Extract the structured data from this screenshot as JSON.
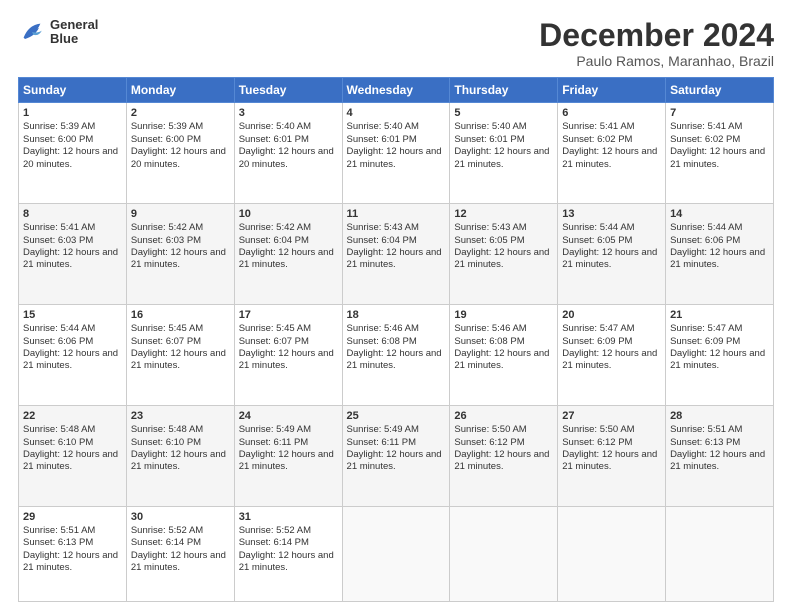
{
  "logo": {
    "line1": "General",
    "line2": "Blue"
  },
  "title": "December 2024",
  "subtitle": "Paulo Ramos, Maranhao, Brazil",
  "days": [
    "Sunday",
    "Monday",
    "Tuesday",
    "Wednesday",
    "Thursday",
    "Friday",
    "Saturday"
  ],
  "weeks": [
    [
      {
        "num": "1",
        "sunrise": "5:39 AM",
        "sunset": "6:00 PM",
        "daylight": "12 hours and 20 minutes."
      },
      {
        "num": "2",
        "sunrise": "5:39 AM",
        "sunset": "6:00 PM",
        "daylight": "12 hours and 20 minutes."
      },
      {
        "num": "3",
        "sunrise": "5:40 AM",
        "sunset": "6:01 PM",
        "daylight": "12 hours and 20 minutes."
      },
      {
        "num": "4",
        "sunrise": "5:40 AM",
        "sunset": "6:01 PM",
        "daylight": "12 hours and 21 minutes."
      },
      {
        "num": "5",
        "sunrise": "5:40 AM",
        "sunset": "6:01 PM",
        "daylight": "12 hours and 21 minutes."
      },
      {
        "num": "6",
        "sunrise": "5:41 AM",
        "sunset": "6:02 PM",
        "daylight": "12 hours and 21 minutes."
      },
      {
        "num": "7",
        "sunrise": "5:41 AM",
        "sunset": "6:02 PM",
        "daylight": "12 hours and 21 minutes."
      }
    ],
    [
      {
        "num": "8",
        "sunrise": "5:41 AM",
        "sunset": "6:03 PM",
        "daylight": "12 hours and 21 minutes."
      },
      {
        "num": "9",
        "sunrise": "5:42 AM",
        "sunset": "6:03 PM",
        "daylight": "12 hours and 21 minutes."
      },
      {
        "num": "10",
        "sunrise": "5:42 AM",
        "sunset": "6:04 PM",
        "daylight": "12 hours and 21 minutes."
      },
      {
        "num": "11",
        "sunrise": "5:43 AM",
        "sunset": "6:04 PM",
        "daylight": "12 hours and 21 minutes."
      },
      {
        "num": "12",
        "sunrise": "5:43 AM",
        "sunset": "6:05 PM",
        "daylight": "12 hours and 21 minutes."
      },
      {
        "num": "13",
        "sunrise": "5:44 AM",
        "sunset": "6:05 PM",
        "daylight": "12 hours and 21 minutes."
      },
      {
        "num": "14",
        "sunrise": "5:44 AM",
        "sunset": "6:06 PM",
        "daylight": "12 hours and 21 minutes."
      }
    ],
    [
      {
        "num": "15",
        "sunrise": "5:44 AM",
        "sunset": "6:06 PM",
        "daylight": "12 hours and 21 minutes."
      },
      {
        "num": "16",
        "sunrise": "5:45 AM",
        "sunset": "6:07 PM",
        "daylight": "12 hours and 21 minutes."
      },
      {
        "num": "17",
        "sunrise": "5:45 AM",
        "sunset": "6:07 PM",
        "daylight": "12 hours and 21 minutes."
      },
      {
        "num": "18",
        "sunrise": "5:46 AM",
        "sunset": "6:08 PM",
        "daylight": "12 hours and 21 minutes."
      },
      {
        "num": "19",
        "sunrise": "5:46 AM",
        "sunset": "6:08 PM",
        "daylight": "12 hours and 21 minutes."
      },
      {
        "num": "20",
        "sunrise": "5:47 AM",
        "sunset": "6:09 PM",
        "daylight": "12 hours and 21 minutes."
      },
      {
        "num": "21",
        "sunrise": "5:47 AM",
        "sunset": "6:09 PM",
        "daylight": "12 hours and 21 minutes."
      }
    ],
    [
      {
        "num": "22",
        "sunrise": "5:48 AM",
        "sunset": "6:10 PM",
        "daylight": "12 hours and 21 minutes."
      },
      {
        "num": "23",
        "sunrise": "5:48 AM",
        "sunset": "6:10 PM",
        "daylight": "12 hours and 21 minutes."
      },
      {
        "num": "24",
        "sunrise": "5:49 AM",
        "sunset": "6:11 PM",
        "daylight": "12 hours and 21 minutes."
      },
      {
        "num": "25",
        "sunrise": "5:49 AM",
        "sunset": "6:11 PM",
        "daylight": "12 hours and 21 minutes."
      },
      {
        "num": "26",
        "sunrise": "5:50 AM",
        "sunset": "6:12 PM",
        "daylight": "12 hours and 21 minutes."
      },
      {
        "num": "27",
        "sunrise": "5:50 AM",
        "sunset": "6:12 PM",
        "daylight": "12 hours and 21 minutes."
      },
      {
        "num": "28",
        "sunrise": "5:51 AM",
        "sunset": "6:13 PM",
        "daylight": "12 hours and 21 minutes."
      }
    ],
    [
      {
        "num": "29",
        "sunrise": "5:51 AM",
        "sunset": "6:13 PM",
        "daylight": "12 hours and 21 minutes."
      },
      {
        "num": "30",
        "sunrise": "5:52 AM",
        "sunset": "6:14 PM",
        "daylight": "12 hours and 21 minutes."
      },
      {
        "num": "31",
        "sunrise": "5:52 AM",
        "sunset": "6:14 PM",
        "daylight": "12 hours and 21 minutes."
      },
      null,
      null,
      null,
      null
    ]
  ]
}
